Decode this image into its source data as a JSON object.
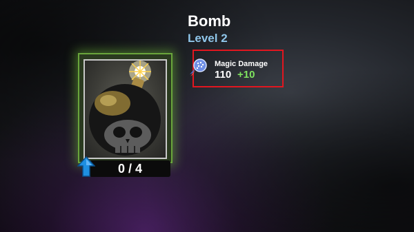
{
  "card": {
    "name": "Bomb",
    "level": "Level 2",
    "progress_text": "0 / 4",
    "progress": {
      "current": 0,
      "total": 4
    },
    "rarity_color": "#6aa63c",
    "art": "bomb-with-skull"
  },
  "stat": {
    "label": "Magic Damage",
    "value": "110",
    "bonus": "+10",
    "icon": "magic-damage-icon",
    "highlighted": true,
    "highlight_color": "#e3161f",
    "bonus_color": "#7fe35f"
  },
  "upgrade": {
    "icon": "upgrade-arrow-icon",
    "color": "#1e8fe0"
  }
}
